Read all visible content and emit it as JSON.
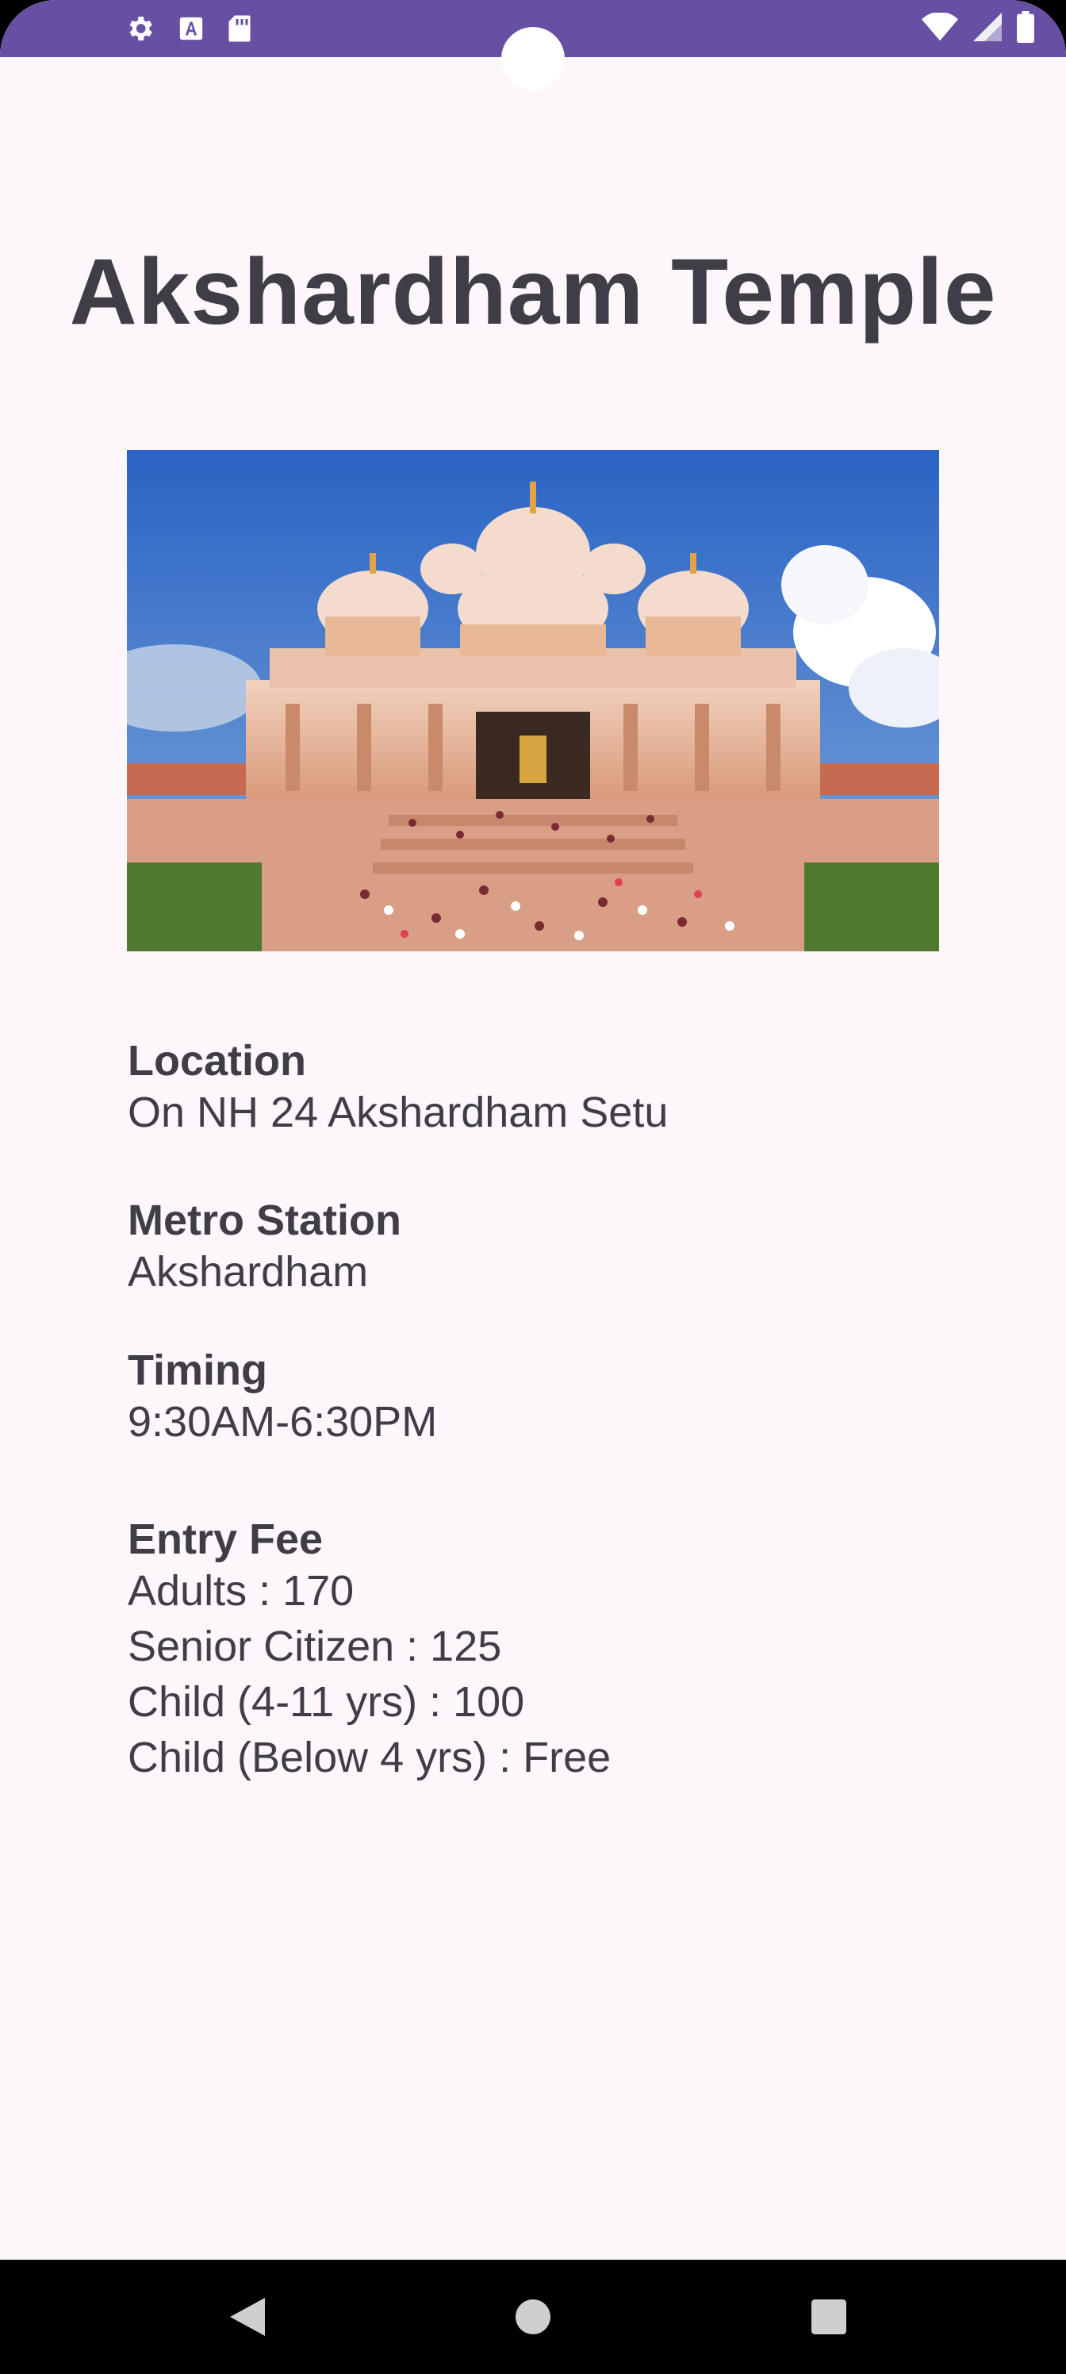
{
  "status_bar": {
    "left_icons": [
      "gear-icon",
      "font-a-icon",
      "sd-card-icon"
    ],
    "right_icons": [
      "wifi-icon",
      "signal-icon",
      "battery-icon"
    ],
    "color": "#6750a4"
  },
  "page": {
    "title": "Akshardham Temple",
    "image": "akshardham-temple-photo"
  },
  "details": {
    "location": {
      "label": "Location",
      "value": "On NH 24 Akshardham Setu"
    },
    "metro": {
      "label": "Metro Station",
      "value": "Akshardham"
    },
    "timing": {
      "label": "Timing",
      "value": "9:30AM-6:30PM"
    },
    "entry_fee": {
      "label": "Entry Fee",
      "lines": [
        "Adults : 170",
        "Senior Citizen : 125",
        "Child (4-11 yrs) : 100",
        "Child (Below 4 yrs) : Free"
      ]
    }
  },
  "nav_bar": {
    "buttons": [
      "back-icon",
      "home-icon",
      "recents-icon"
    ]
  }
}
